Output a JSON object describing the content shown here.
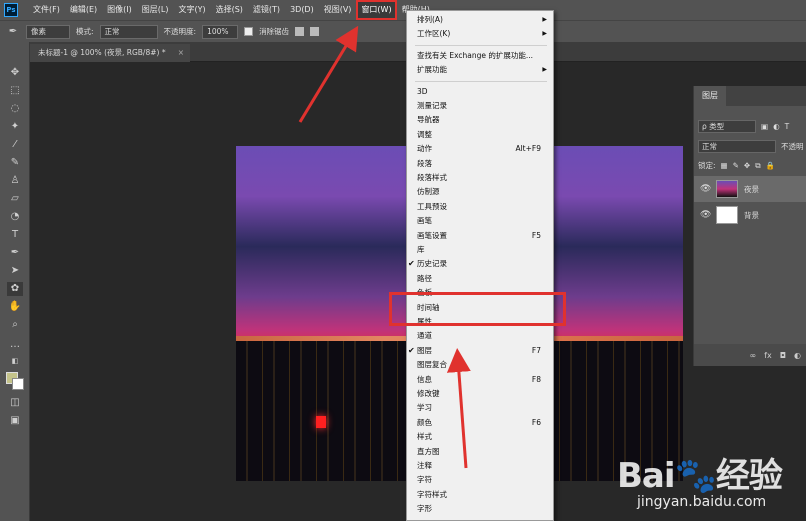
{
  "app": {
    "logo": "Ps",
    "menus": [
      "文件(F)",
      "编辑(E)",
      "图像(I)",
      "图层(L)",
      "文字(Y)",
      "选择(S)",
      "滤镜(T)",
      "3D(D)",
      "视图(V)",
      "窗口(W)",
      "帮助(H)"
    ],
    "active_menu": "窗口(W)"
  },
  "options": {
    "fill_label": "像素",
    "mode_label": "模式:",
    "mode_value": "正常",
    "opacity_label": "不透明度:",
    "opacity_value": "100%",
    "antialias_label": "消除锯齿"
  },
  "document": {
    "tab_title": "未标题-1 @ 100% (夜景, RGB/8#) *",
    "close_glyph": "×"
  },
  "window_menu": {
    "items": [
      {
        "label": "排列(A)",
        "submenu": true
      },
      {
        "label": "工作区(K)",
        "submenu": true
      },
      {
        "sep": true
      },
      {
        "label": "查找有关 Exchange 的扩展功能..."
      },
      {
        "label": "扩展功能",
        "submenu": true
      },
      {
        "sep": true
      },
      {
        "label": "3D"
      },
      {
        "label": "测量记录"
      },
      {
        "label": "导航器"
      },
      {
        "label": "调整"
      },
      {
        "label": "动作",
        "shortcut": "Alt+F9"
      },
      {
        "label": "段落"
      },
      {
        "label": "段落样式"
      },
      {
        "label": "仿制源"
      },
      {
        "label": "工具预设"
      },
      {
        "label": "画笔"
      },
      {
        "label": "画笔设置",
        "shortcut": "F5"
      },
      {
        "label": "库"
      },
      {
        "label": "历史记录",
        "checked": true
      },
      {
        "label": "路径"
      },
      {
        "label": "色板"
      },
      {
        "label": "时间轴"
      },
      {
        "label": "属性"
      },
      {
        "label": "通道"
      },
      {
        "label": "图层",
        "shortcut": "F7",
        "checked": true
      },
      {
        "label": "图层复合"
      },
      {
        "label": "信息",
        "shortcut": "F8"
      },
      {
        "label": "修改键"
      },
      {
        "label": "学习"
      },
      {
        "label": "颜色",
        "shortcut": "F6"
      },
      {
        "label": "样式"
      },
      {
        "label": "直方图"
      },
      {
        "label": "注释"
      },
      {
        "label": "字符"
      },
      {
        "label": "字符样式"
      },
      {
        "label": "字形"
      }
    ],
    "submenu_glyph": "▶",
    "check_glyph": "✔"
  },
  "layers_panel": {
    "title": "图层",
    "kind_filter": "ρ 类型",
    "blend_mode": "正常",
    "opacity_label": "不透明",
    "lock_label": "锁定:",
    "layers": [
      {
        "name": "夜景",
        "selected": true
      },
      {
        "name": "背景",
        "selected": false
      }
    ],
    "footer_icons": [
      "∞",
      "fx",
      "◘",
      "◐"
    ]
  },
  "watermark": {
    "logo": "Bai🐾经验",
    "url": "jingyan.baidu.com"
  },
  "colors": {
    "highlight": "#e0322e",
    "menu_bg": "#f0f0f0",
    "ui_bg": "#535353"
  }
}
